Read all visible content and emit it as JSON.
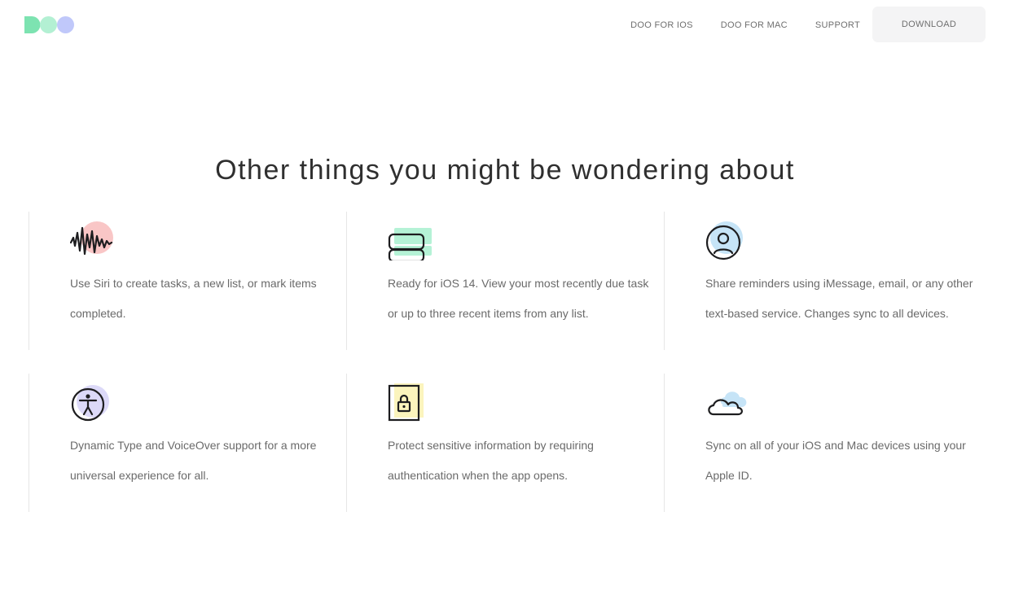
{
  "header": {
    "nav": [
      {
        "label": "DOO FOR IOS"
      },
      {
        "label": "DOO FOR MAC"
      },
      {
        "label": "SUPPORT"
      }
    ],
    "download_label": "DOWNLOAD"
  },
  "colors": {
    "logo_d": "#7de3b1",
    "logo_o1": "#b3f0d3",
    "logo_o2": "#c0c8fa",
    "icon_stroke": "#1d1d1f",
    "text": "#6a6a6a",
    "title": "#2f2f2f"
  },
  "section": {
    "title": "Other things you might be wondering about"
  },
  "features": [
    {
      "icon": "siri-waveform-icon",
      "text": "Use Siri to create tasks, a new list, or mark items completed."
    },
    {
      "icon": "widgets-icon",
      "text": "Ready for iOS 14. View your most recently due task or up to three recent items from any list."
    },
    {
      "icon": "user-profile-icon",
      "text": "Share reminders using iMessage, email, or any other text-based service. Changes sync to all devices."
    },
    {
      "icon": "accessibility-icon",
      "text": "Dynamic Type and VoiceOver support for a more universal experience for all."
    },
    {
      "icon": "lock-icon",
      "text": "Protect sensitive information by requiring authentication when the app opens."
    },
    {
      "icon": "cloud-icon",
      "text": "Sync on all of your iOS and Mac devices using your Apple ID."
    }
  ]
}
